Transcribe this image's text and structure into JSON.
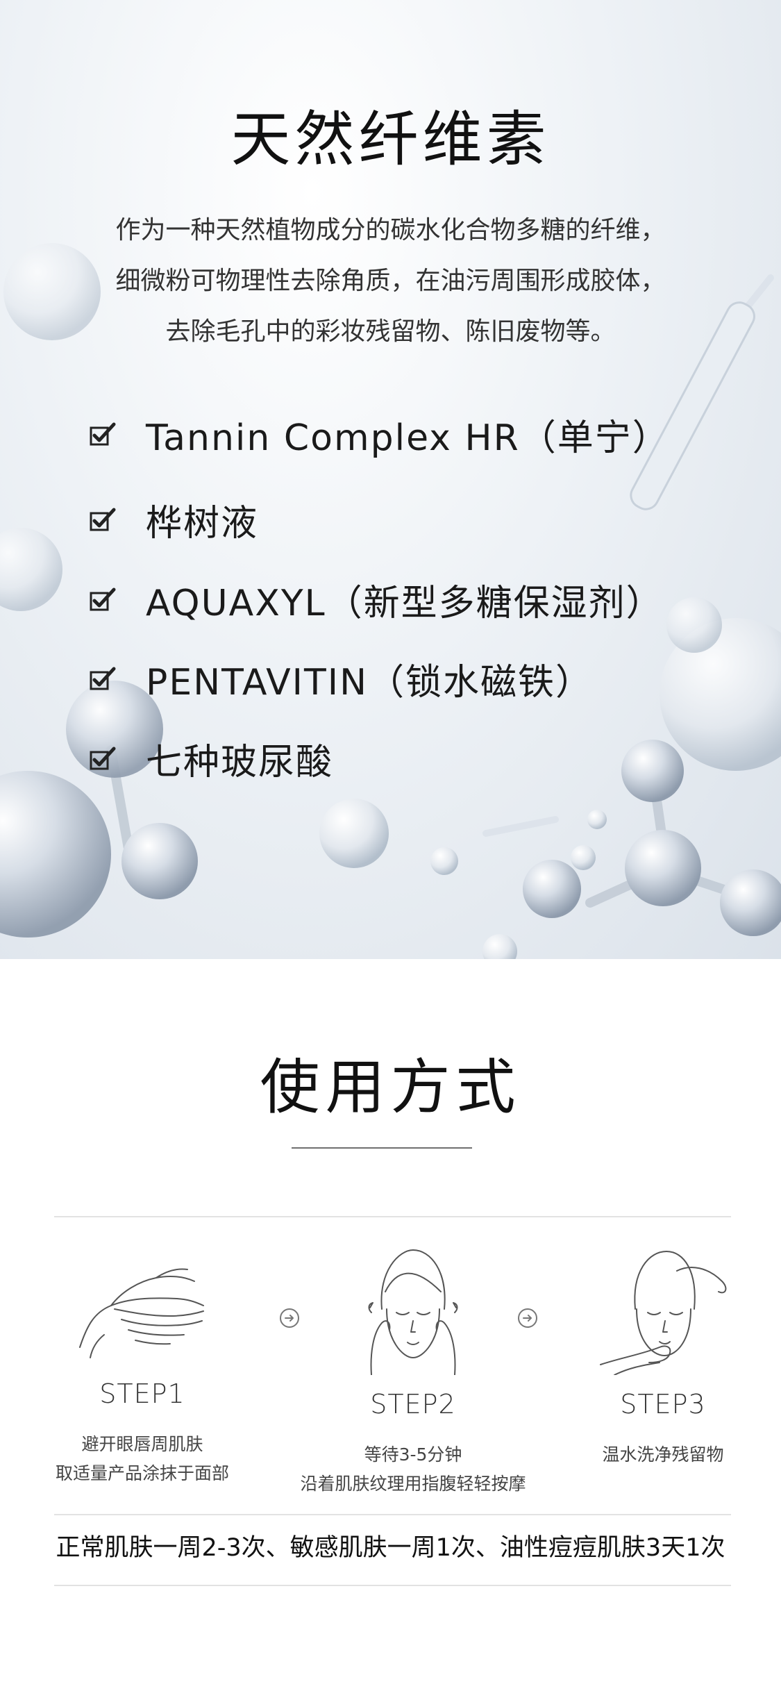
{
  "hero": {
    "title": "天然纤维素",
    "description": [
      "作为一种天然植物成分的碳水化合物多糖的纤维，",
      "细微粉可物理性去除角质，在油污周围形成胶体，",
      "去除毛孔中的彩妆残留物、陈旧废物等。"
    ],
    "features": [
      "Tannin Complex HR（单宁）",
      "桦树液",
      "AQUAXYL（新型多糖保湿剂）",
      "PENTAVITIN（锁水磁铁）",
      "七种玻尿酸"
    ],
    "check_icon": "checkbox-tick-icon"
  },
  "usage": {
    "title": "使用方式",
    "steps": [
      {
        "label": "STEP1",
        "icon": "hands-pump-icon",
        "desc": [
          "避开眼唇周肌肤",
          "取适量产品涂抹于面部"
        ]
      },
      {
        "label": "STEP2",
        "icon": "face-massage-icon",
        "desc": [
          "等待3-5分钟",
          "沿着肌肤纹理用指腹轻轻按摩"
        ]
      },
      {
        "label": "STEP3",
        "icon": "face-rinse-icon",
        "desc": [
          "温水洗净残留物"
        ]
      }
    ],
    "arrow_icon": "circle-arrow-right-icon",
    "frequency": "正常肌肤一周2-3次、敏感肌肤一周1次、油性痘痘肌肤3天1次"
  },
  "colors": {
    "text": "#111111",
    "hero_bg": "#dbe2ea",
    "molecule": "#c7d0da",
    "line": "#e2e2e2"
  }
}
